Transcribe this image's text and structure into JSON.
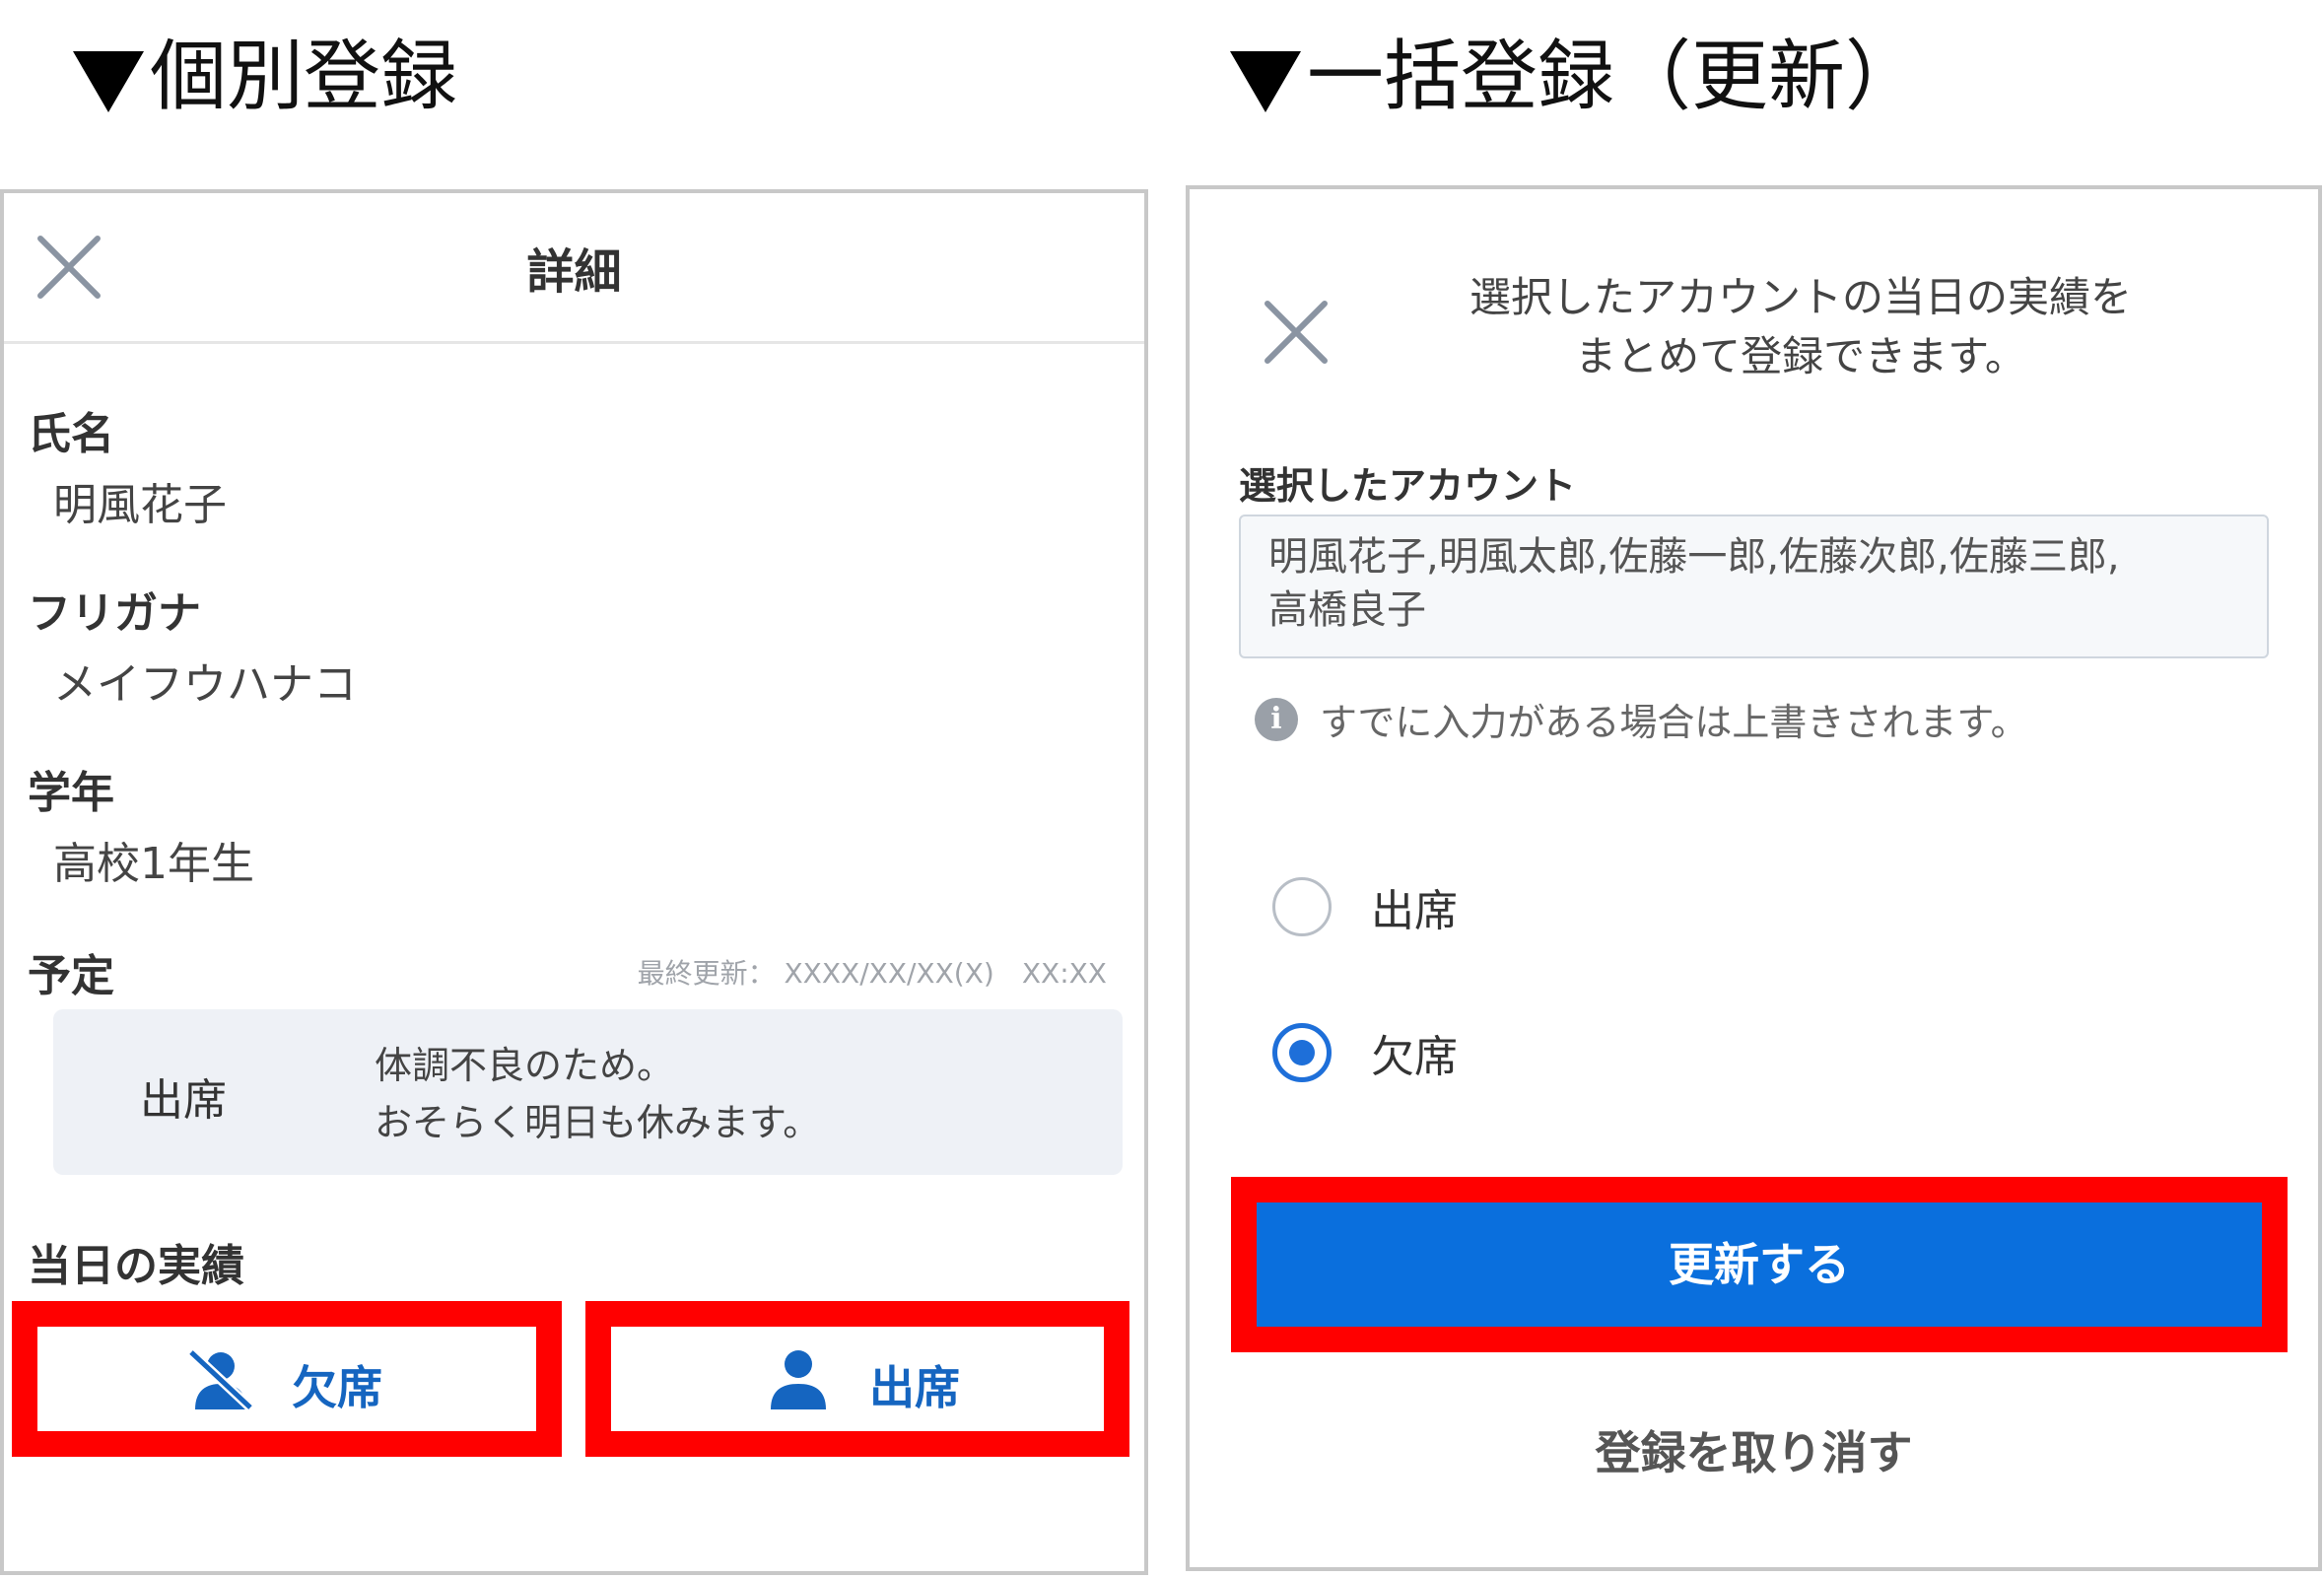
{
  "headings": {
    "individual": "個別登録",
    "bulk": "一括登録（更新）"
  },
  "detail_panel": {
    "title": "詳細",
    "fields": {
      "name_label": "氏名",
      "name_value": "明風花子",
      "furigana_label": "フリガナ",
      "furigana_value": "メイフウハナコ",
      "grade_label": "学年",
      "grade_value": "高校1年生"
    },
    "schedule": {
      "label": "予定",
      "last_updated": "最終更新： XXXX/XX/XX(X)　XX:XX",
      "status": "出席",
      "note_line1": "体調不良のため。",
      "note_line2": "おそらく明日も休みます。"
    },
    "actual": {
      "label": "当日の実績",
      "absent_button": "欠席",
      "present_button": "出席"
    }
  },
  "bulk_panel": {
    "message_line1": "選択したアカウントの当日の実績を",
    "message_line2": "まとめて登録できます。",
    "selected_label": "選択したアカウント",
    "selected_accounts": "明風花子,明風太郎,佐藤一郎,佐藤次郎,佐藤三郎,\n高橋良子",
    "info": "すでに入力がある場合は上書きされます。",
    "options": [
      {
        "label": "出席",
        "selected": false
      },
      {
        "label": "欠席",
        "selected": true
      }
    ],
    "update_button": "更新する",
    "cancel_link": "登録を取り消す"
  },
  "colors": {
    "accent": "#0a6fdd",
    "highlight_frame": "#ff0000",
    "button_text": "#1565c0"
  }
}
